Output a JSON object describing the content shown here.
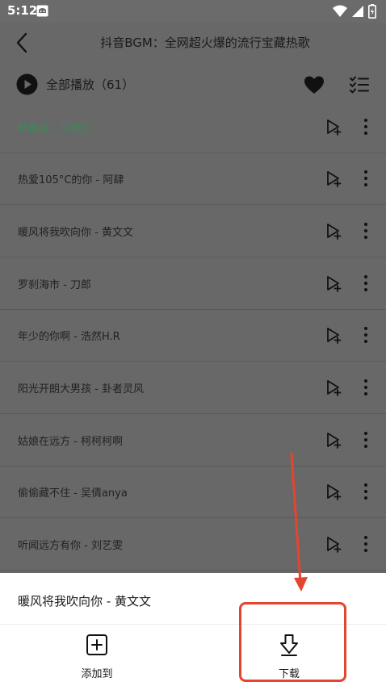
{
  "status_bar": {
    "time": "5:12",
    "icons": [
      "app-notification-icon",
      "wifi-icon",
      "signal-icon",
      "battery-icon"
    ]
  },
  "header": {
    "title": "抖音BGM：全网超火爆的流行宝藏热歌",
    "back_icon": "chevron-left-icon"
  },
  "toolbar": {
    "play_all_label": "全部播放（61）",
    "icons": [
      "play-circle-icon",
      "heart-icon",
      "checklist-icon"
    ]
  },
  "songs": [
    {
      "title": "就像爱 - 吴佳忆",
      "playing": true
    },
    {
      "title": "热爱105°C的你 - 阿肆",
      "playing": false
    },
    {
      "title": "暖风将我吹向你 - 黄文文",
      "playing": false
    },
    {
      "title": "罗刹海市 - 刀郎",
      "playing": false
    },
    {
      "title": "年少的你啊 - 浩然H.R",
      "playing": false
    },
    {
      "title": "阳光开朗大男孩 - 卦者灵风",
      "playing": false
    },
    {
      "title": "姑娘在远方 - 柯柯柯啊",
      "playing": false
    },
    {
      "title": "偷偷藏不住 - 吴倩anya",
      "playing": false
    },
    {
      "title": "听闻远方有你 - 刘艺雯",
      "playing": false
    }
  ],
  "bottom_sheet": {
    "song_title": "暖风将我吹向你 - 黄文文",
    "actions": [
      {
        "label": "添加到",
        "icon": "plus-square-icon"
      },
      {
        "label": "下载",
        "icon": "download-arrow-icon"
      }
    ]
  },
  "colors": {
    "overlay_gray": "#686868",
    "playing_green": "#3a8a52",
    "annotation_red": "#e4452f"
  }
}
